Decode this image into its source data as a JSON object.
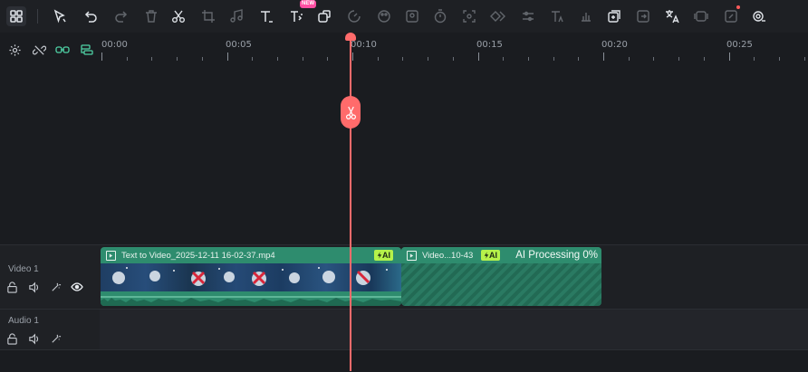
{
  "toolbar": {
    "new_badge": "NEW",
    "tools": [
      "layout-icon",
      "select-arrow-icon",
      "undo-icon",
      "redo-icon",
      "delete-icon",
      "cut-icon",
      "crop-icon",
      "audio-icon",
      "text-icon",
      "ai-text-icon",
      "transform-icon",
      "speed-icon",
      "color-icon",
      "ai-portrait-icon",
      "timer-icon",
      "stabilize-icon",
      "keyframe-icon",
      "adjust-icon",
      "ai-text-style-icon",
      "silence-icon",
      "ai-extend-icon",
      "export-frame-icon",
      "translate-icon",
      "ai-frame-icon",
      "ai-edit-icon",
      "ai-tools-icon"
    ]
  },
  "ruler": {
    "labels": [
      "00:00",
      "00:05",
      "00:10",
      "00:15",
      "00:20",
      "00:25"
    ]
  },
  "tracks": {
    "video": {
      "name": "Video 1"
    },
    "audio": {
      "name": "Audio 1"
    }
  },
  "clips": {
    "clip1": {
      "title": "Text to Video_2025-12-11 16-02-37.mp4",
      "badge": "AI"
    },
    "clip2": {
      "title": "Video...10-43",
      "badge": "AI",
      "status": "AI Processing 0%"
    }
  },
  "colors": {
    "accent": "#ff6b6b",
    "clip_green": "#2e8c6e",
    "ai_badge": "#b6f24a"
  }
}
